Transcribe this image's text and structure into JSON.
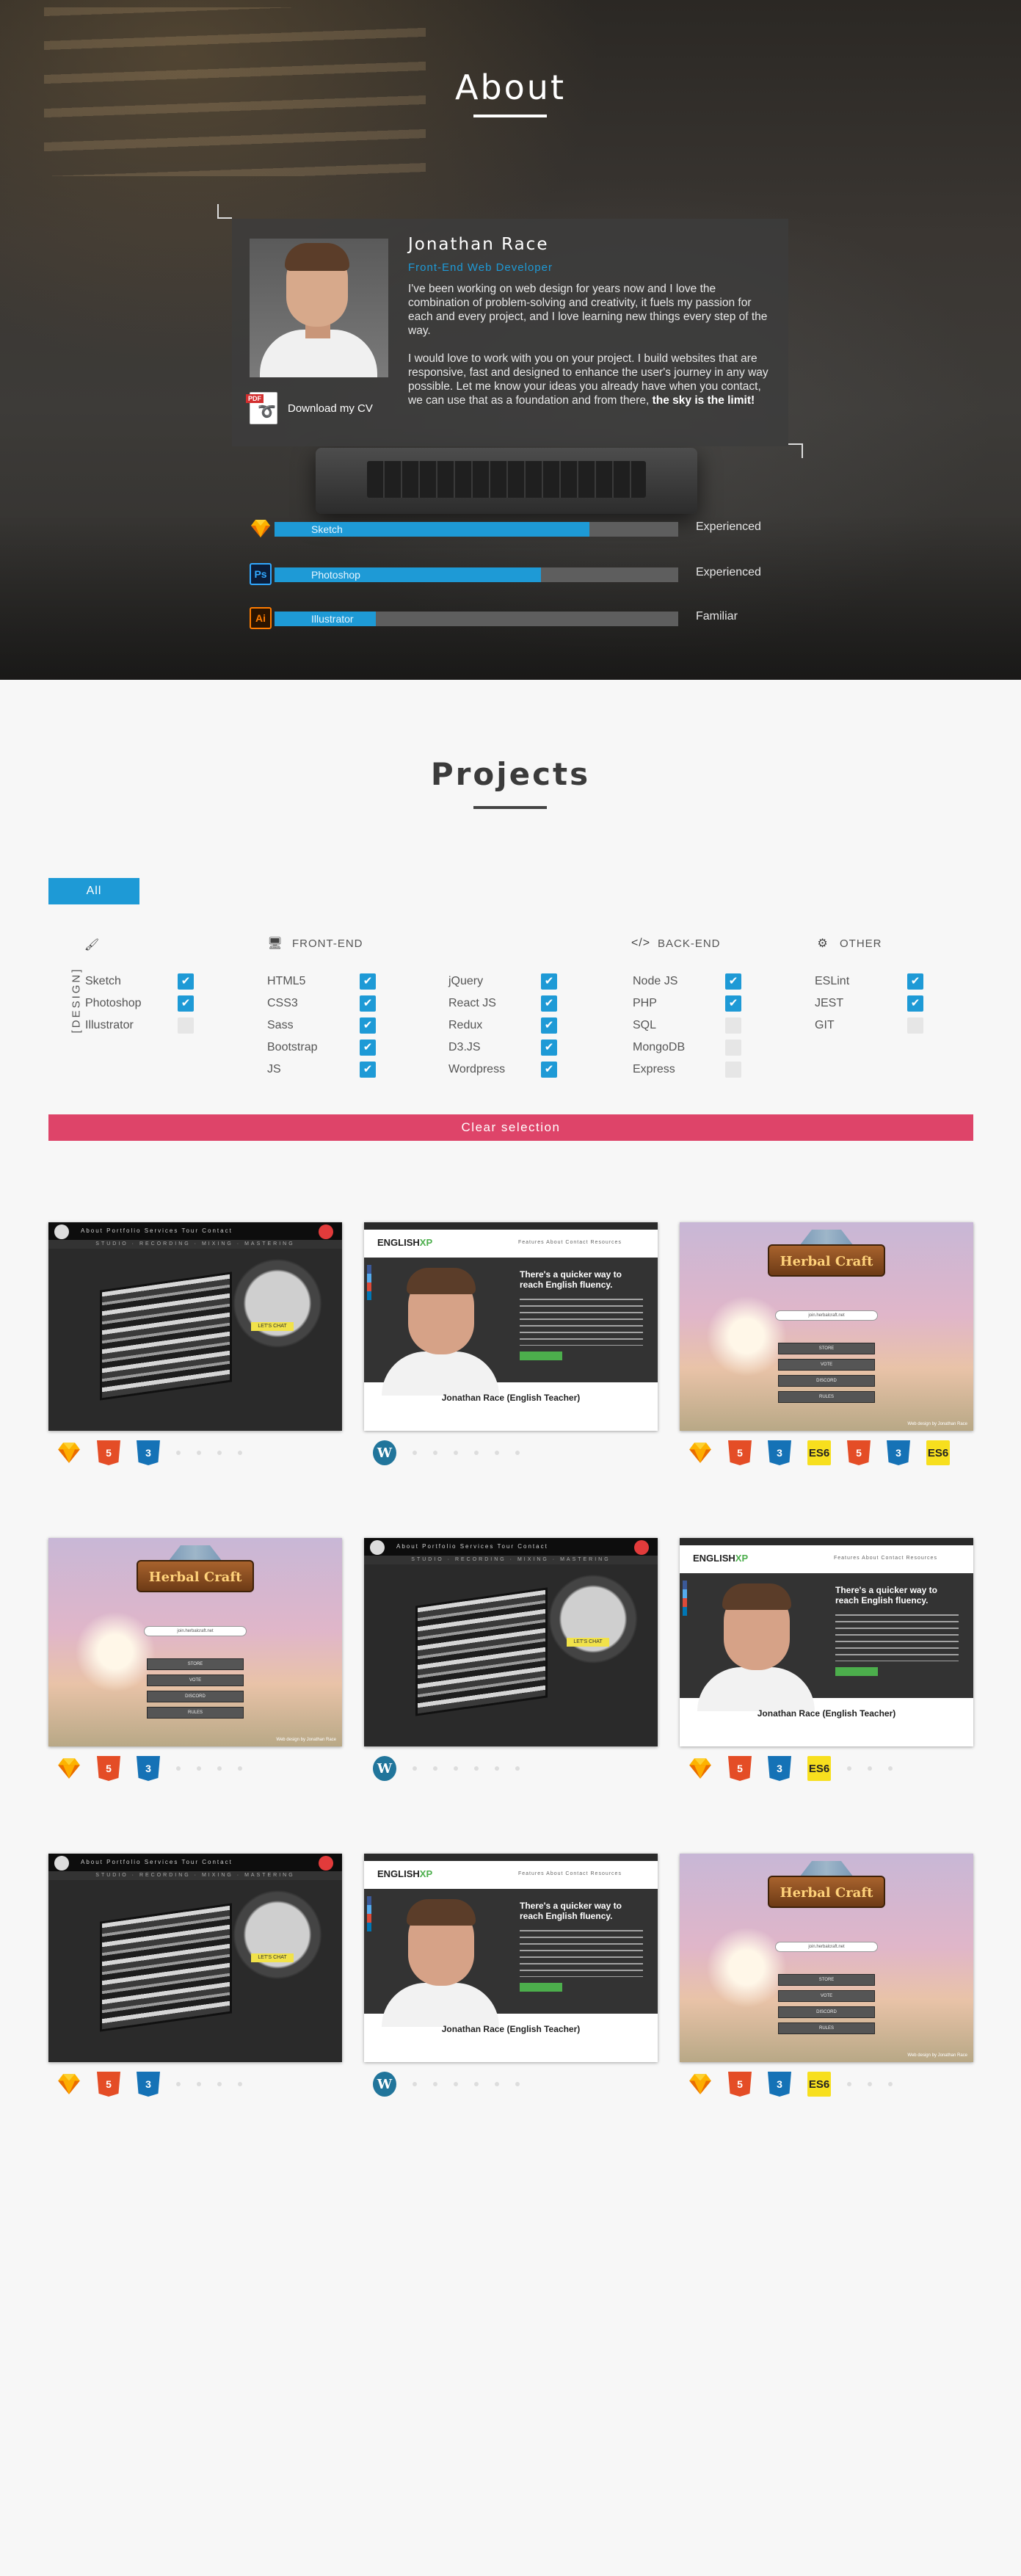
{
  "about": {
    "title": "About",
    "name": "Jonathan Race",
    "role": "Front-End Web Developer",
    "bio_p1": "I've been working on web design for years now and I love the combination of problem-solving and creativity, it fuels my passion for each and every project, and I love learning new things every step of the way.",
    "bio_p2": "I would love to work with you on your project. I build websites that are responsive, fast and designed to enhance the user's journey in any way possible. Let me know your ideas you already have when you contact, we can use that as a foundation and from there, ",
    "bio_p2_bold": "the sky is the limit!",
    "cv_label": "Download my CV",
    "pdf_tag": "PDF",
    "skills": [
      {
        "name": "Sketch",
        "level": "Experienced",
        "progress": 0.78,
        "icon": "sketch-icon"
      },
      {
        "name": "Photoshop",
        "level": "Experienced",
        "progress": 0.66,
        "icon": "photoshop-icon",
        "abbr": "Ps"
      },
      {
        "name": "Illustrator",
        "level": "Familiar",
        "progress": 0.25,
        "icon": "illustrator-icon",
        "abbr": "Ai"
      }
    ]
  },
  "projects": {
    "title": "Projects",
    "all_label": "All",
    "clear_label": "Clear selection",
    "filters": {
      "design": {
        "label": "DESIGN",
        "icon": "brush-icon",
        "items": [
          {
            "label": "Sketch",
            "checked": true
          },
          {
            "label": "Photoshop",
            "checked": true
          },
          {
            "label": "Illustrator",
            "checked": false
          }
        ]
      },
      "frontend": {
        "label": "FRONT-END",
        "icon": "monitor-icon",
        "items": [
          {
            "label": "HTML5",
            "checked": true
          },
          {
            "label": "CSS3",
            "checked": true
          },
          {
            "label": "Sass",
            "checked": true
          },
          {
            "label": "Bootstrap",
            "checked": true
          },
          {
            "label": "JS",
            "checked": true
          }
        ]
      },
      "frontend2": {
        "items": [
          {
            "label": "jQuery",
            "checked": true
          },
          {
            "label": "React JS",
            "checked": true
          },
          {
            "label": "Redux",
            "checked": true
          },
          {
            "label": "D3.JS",
            "checked": true
          },
          {
            "label": "Wordpress",
            "checked": true
          }
        ]
      },
      "backend": {
        "label": "BACK-END",
        "icon": "code-icon",
        "items": [
          {
            "label": "Node JS",
            "checked": true
          },
          {
            "label": "PHP",
            "checked": true
          },
          {
            "label": "SQL",
            "checked": false
          },
          {
            "label": "MongoDB",
            "checked": false
          },
          {
            "label": "Express",
            "checked": false
          }
        ]
      },
      "other": {
        "label": "OTHER",
        "icon": "gears-icon",
        "items": [
          {
            "label": "ESLint",
            "checked": true
          },
          {
            "label": "JEST",
            "checked": true
          },
          {
            "label": "GIT",
            "checked": false
          }
        ]
      }
    },
    "thumb_text": {
      "studio_banner": "STUDIO · RECORDING · MIXING · MASTERING",
      "studio_nav": "About  Portfolio  Services  Tour  Contact",
      "studio_cta": "LET'S CHAT",
      "english_brand": "ENGLISH",
      "english_brand_accent": "XP",
      "english_menu": "Features   About   Contact   Resources",
      "english_headline": "There's a quicker way to reach English fluency.",
      "english_caption": "Jonathan Race (English Teacher)",
      "herbal_title": "Herbal Craft",
      "herbal_ip": "join.herbalcraft.net",
      "herbal_buttons": [
        "STORE",
        "VOTE",
        "DISCORD",
        "RULES"
      ],
      "herbal_credit": "Web design by Jonathan Race"
    },
    "tech_sets": {
      "studio": [
        "sketch",
        "html5",
        "css3"
      ],
      "english": [
        "wordpress"
      ],
      "herbal_full": [
        "sketch",
        "html5",
        "css3",
        "es6",
        "html5",
        "css3",
        "es6"
      ],
      "herbal_short": [
        "sketch",
        "html5",
        "css3"
      ],
      "english_es6": [
        "sketch",
        "html5",
        "css3",
        "es6"
      ],
      "herbal_es6": [
        "sketch",
        "html5",
        "css3",
        "es6"
      ]
    },
    "tech_glyphs": {
      "html5": "5",
      "css3": "3",
      "es6": "ES6",
      "wordpress": "W"
    },
    "colors": {
      "accent": "#1e9ad6",
      "clear": "#de4469",
      "html5": "#e44d26",
      "css3": "#1572b6",
      "es6": "#f7df1e",
      "wordpress": "#21759b"
    }
  }
}
